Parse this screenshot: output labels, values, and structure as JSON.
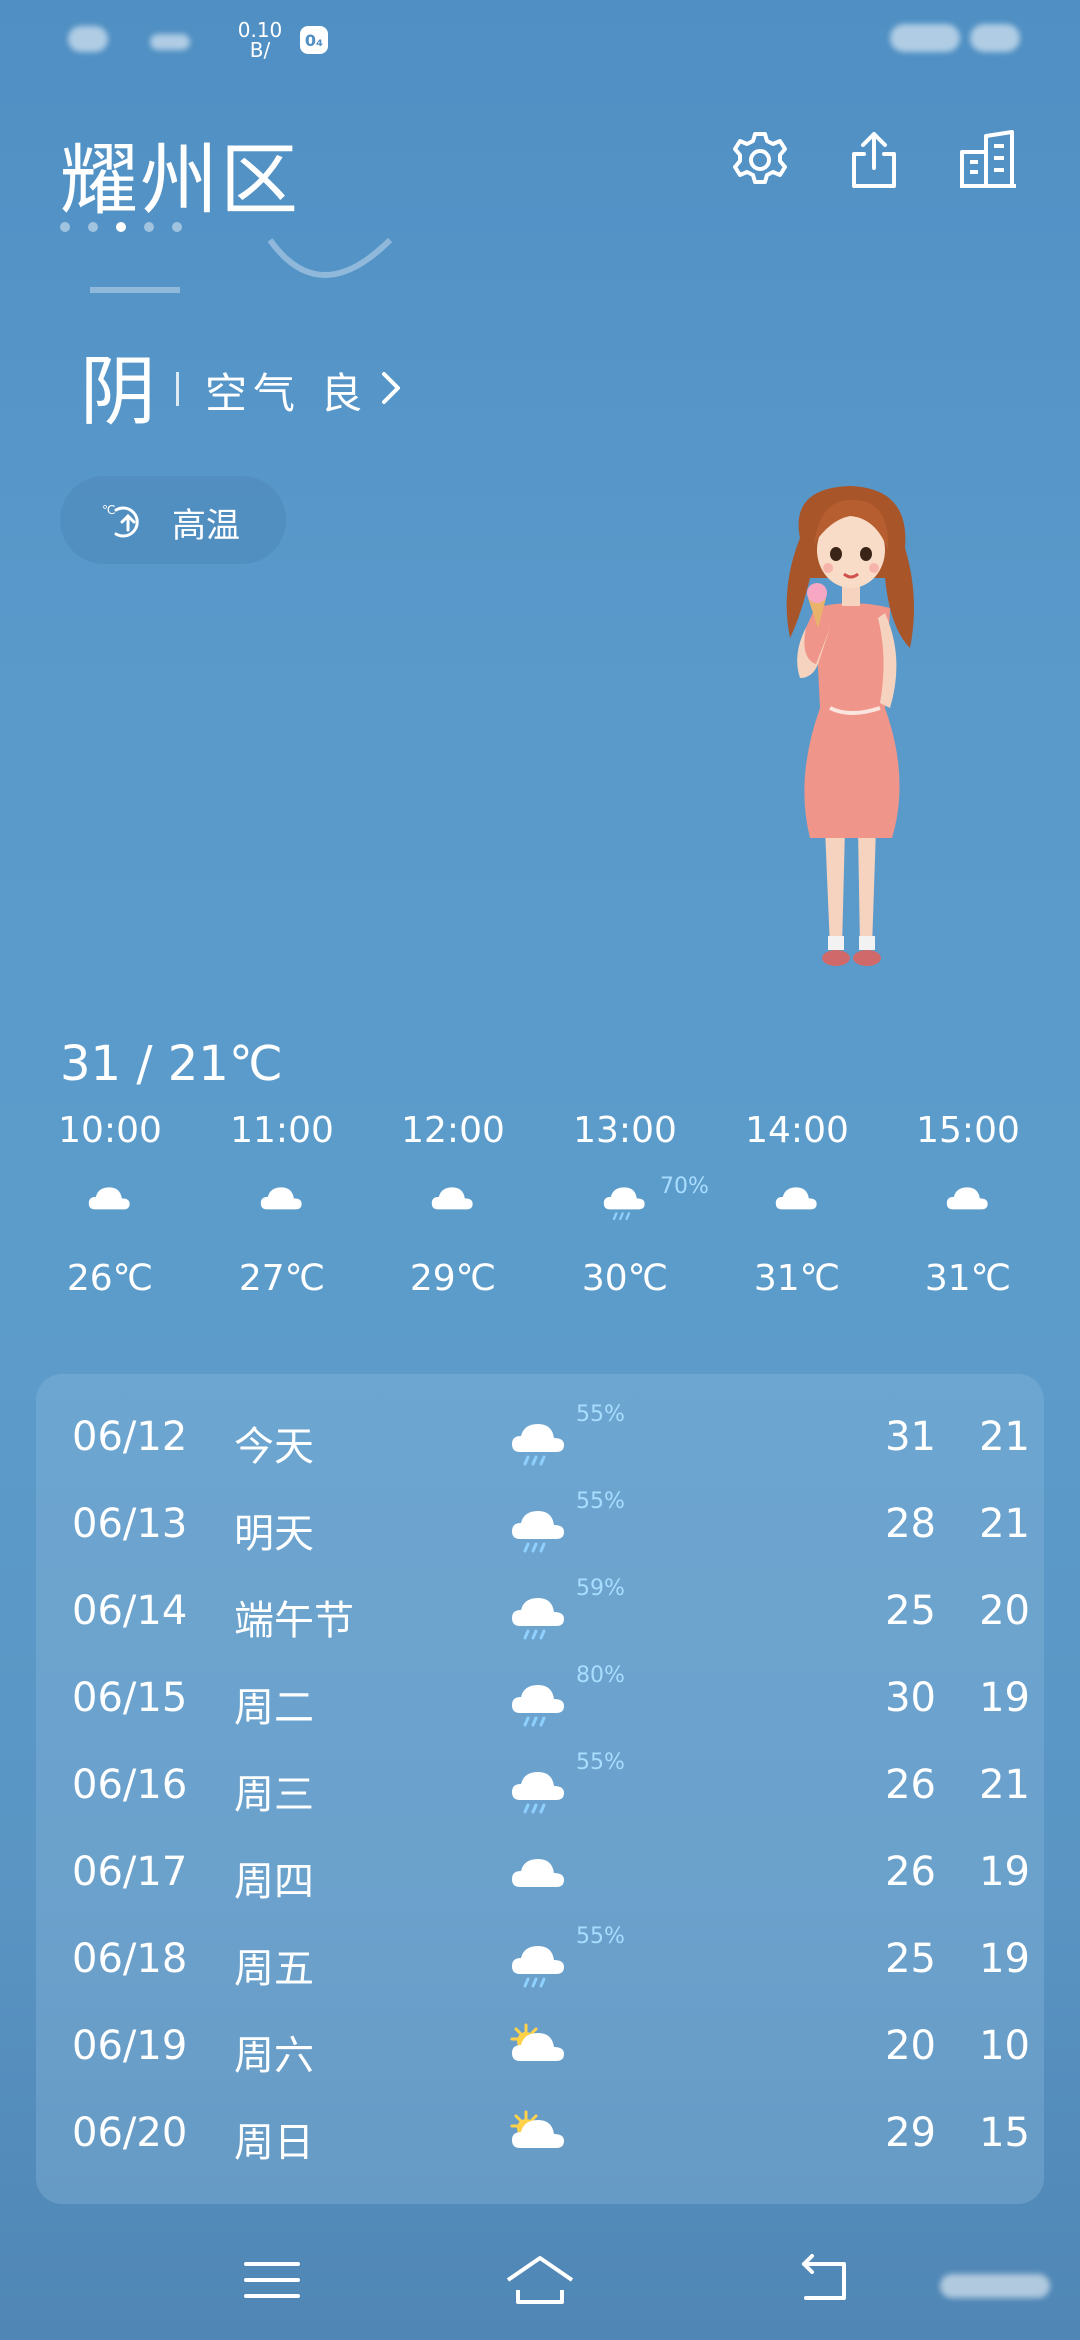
{
  "status_bar": {
    "net_speed": "0.10",
    "net_unit": "B/",
    "badge": "0₄"
  },
  "header": {
    "city": "耀州区",
    "pages": 5,
    "active_page": 3
  },
  "current": {
    "condition": "阴",
    "air_quality": "空气 良"
  },
  "alert": {
    "label": "高温",
    "icon": "thermometer-up-icon"
  },
  "today_range": "31 / 21℃",
  "hourly": [
    {
      "time": "10:00",
      "icon": "cloud-icon",
      "temp": "26℃",
      "precip": ""
    },
    {
      "time": "11:00",
      "icon": "cloud-icon",
      "temp": "27℃",
      "precip": ""
    },
    {
      "time": "12:00",
      "icon": "cloud-icon",
      "temp": "29℃",
      "precip": ""
    },
    {
      "time": "13:00",
      "icon": "rain-cloud-icon",
      "temp": "30℃",
      "precip": "70%"
    },
    {
      "time": "14:00",
      "icon": "cloud-icon",
      "temp": "31℃",
      "precip": ""
    },
    {
      "time": "15:00",
      "icon": "cloud-icon",
      "temp": "31℃",
      "precip": ""
    }
  ],
  "daily": [
    {
      "date": "06/12",
      "name": "今天",
      "icon": "rain-cloud-icon",
      "precip": "55%",
      "high": "31",
      "low": "21"
    },
    {
      "date": "06/13",
      "name": "明天",
      "icon": "rain-cloud-icon",
      "precip": "55%",
      "high": "28",
      "low": "21"
    },
    {
      "date": "06/14",
      "name": "端午节",
      "icon": "rain-cloud-icon",
      "precip": "59%",
      "high": "25",
      "low": "20"
    },
    {
      "date": "06/15",
      "name": "周二",
      "icon": "rain-cloud-icon",
      "precip": "80%",
      "high": "30",
      "low": "19"
    },
    {
      "date": "06/16",
      "name": "周三",
      "icon": "rain-cloud-icon",
      "precip": "55%",
      "high": "26",
      "low": "21"
    },
    {
      "date": "06/17",
      "name": "周四",
      "icon": "cloud-icon",
      "precip": "",
      "high": "26",
      "low": "19"
    },
    {
      "date": "06/18",
      "name": "周五",
      "icon": "rain-cloud-icon",
      "precip": "55%",
      "high": "25",
      "low": "19"
    },
    {
      "date": "06/19",
      "name": "周六",
      "icon": "partly-sunny-icon",
      "precip": "",
      "high": "20",
      "low": "10"
    },
    {
      "date": "06/20",
      "name": "周日",
      "icon": "partly-sunny-icon",
      "precip": "",
      "high": "29",
      "low": "15"
    }
  ],
  "colors": {
    "precip_text": "#a9ddff",
    "sun": "#ffd24a"
  }
}
